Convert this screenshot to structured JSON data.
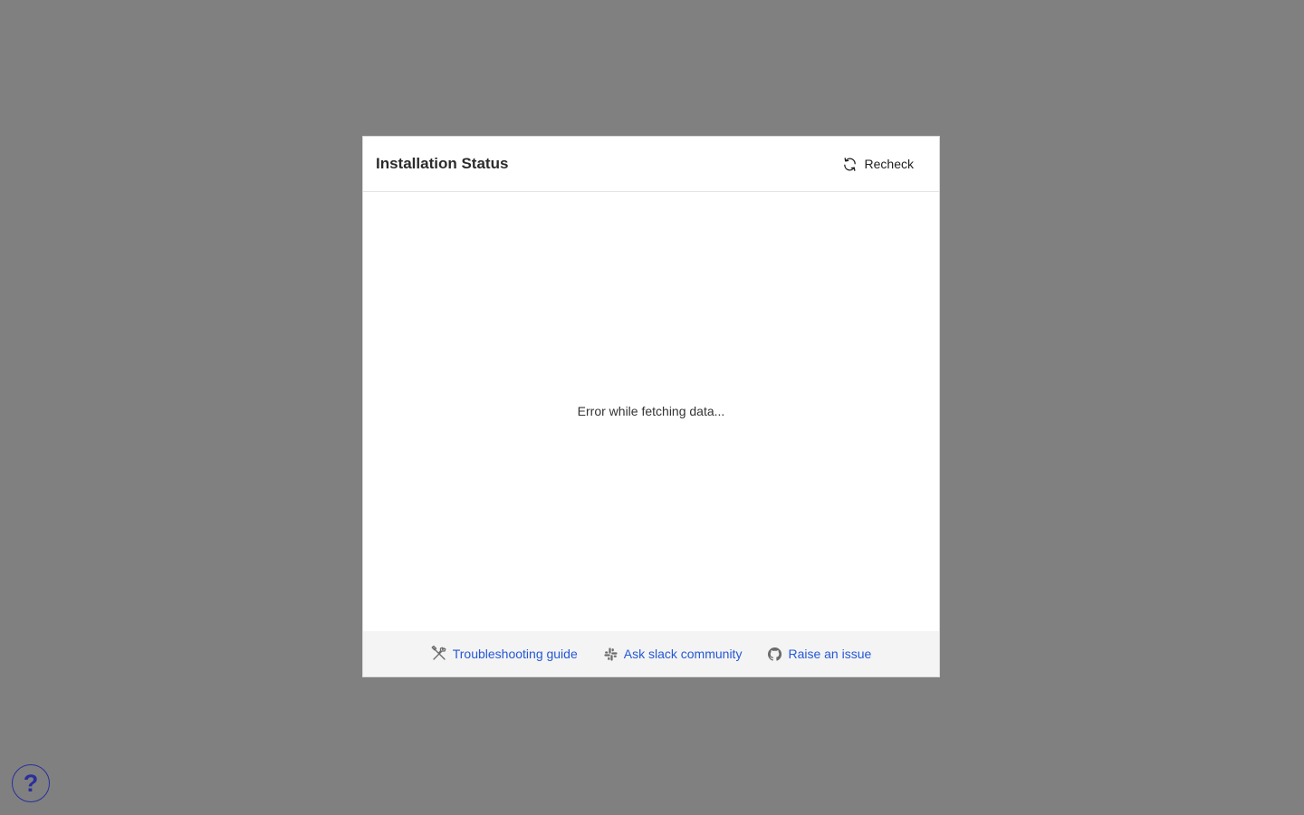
{
  "modal": {
    "title": "Installation Status",
    "recheck_label": "Recheck",
    "body_message": "Error while fetching data..."
  },
  "footer": {
    "links": [
      {
        "label": "Troubleshooting guide",
        "icon": "tools-icon"
      },
      {
        "label": "Ask slack community",
        "icon": "slack-icon"
      },
      {
        "label": "Raise an issue",
        "icon": "github-icon"
      }
    ]
  },
  "help_button": {
    "glyph": "?"
  },
  "colors": {
    "overlay": "#808080",
    "link": "#2557d6",
    "help": "#2a2f9c",
    "footer_bg": "#f4f4f4"
  }
}
